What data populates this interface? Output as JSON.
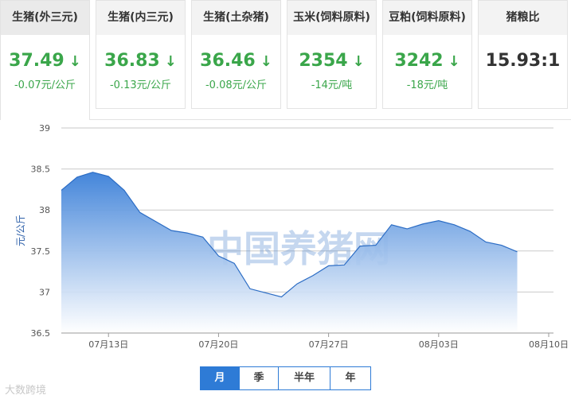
{
  "cards": [
    {
      "title": "生猪(外三元)",
      "price": "37.49",
      "arrow": "↓",
      "change": "-0.07元/公斤"
    },
    {
      "title": "生猪(内三元)",
      "price": "36.83",
      "arrow": "↓",
      "change": "-0.13元/公斤"
    },
    {
      "title": "生猪(土杂猪)",
      "price": "36.46",
      "arrow": "↓",
      "change": "-0.08元/公斤"
    },
    {
      "title": "玉米(饲料原料)",
      "price": "2354",
      "arrow": "↓",
      "change": "-14元/吨"
    },
    {
      "title": "豆粕(饲料原料)",
      "price": "3242",
      "arrow": "↓",
      "change": "-18元/吨"
    },
    {
      "title": "猪粮比",
      "price": "15.93:1"
    }
  ],
  "tabs": [
    "月",
    "季",
    "半年",
    "年"
  ],
  "active_tab": "月",
  "watermark": {
    "main": "中国养猪网",
    "logo": "大数跨境"
  },
  "colors": {
    "down": "#3aa64a",
    "accent": "#2e7bd6",
    "area_top": "#3a7fd8",
    "area_bottom": "#ffffff",
    "line": "#2b6cc4"
  },
  "icons": [
    "down-arrow-icon"
  ],
  "chart_data": {
    "type": "area",
    "ylabel": "元/公斤",
    "ylim": [
      36.5,
      39
    ],
    "yticks": [
      36.5,
      37,
      37.5,
      38,
      38.5,
      39
    ],
    "grid": true,
    "xticks": [
      "07月13日",
      "07月20日",
      "07月27日",
      "08月03日",
      "08月10日"
    ],
    "x": [
      "07月10日",
      "07月11日",
      "07月12日",
      "07月13日",
      "07月14日",
      "07月15日",
      "07月16日",
      "07月17日",
      "07月18日",
      "07月19日",
      "07月20日",
      "07月21日",
      "07月22日",
      "07月23日",
      "07月24日",
      "07月25日",
      "07月26日",
      "07月27日",
      "07月28日",
      "07月29日",
      "07月30日",
      "07月31日",
      "08月01日",
      "08月02日",
      "08月03日",
      "08月04日",
      "08月05日",
      "08月06日",
      "08月07日",
      "08月08日",
      "08月09日",
      "08月10日"
    ],
    "series": [
      {
        "values": [
          38.24,
          38.4,
          38.46,
          38.41,
          38.24,
          37.97,
          37.86,
          37.75,
          37.72,
          37.67,
          37.44,
          37.35,
          37.04,
          36.99,
          36.94,
          37.1,
          37.2,
          37.32,
          37.33,
          37.56,
          37.57,
          37.82,
          37.77,
          37.83,
          37.87,
          37.82,
          37.74,
          37.61,
          37.57,
          37.49
        ]
      }
    ]
  }
}
